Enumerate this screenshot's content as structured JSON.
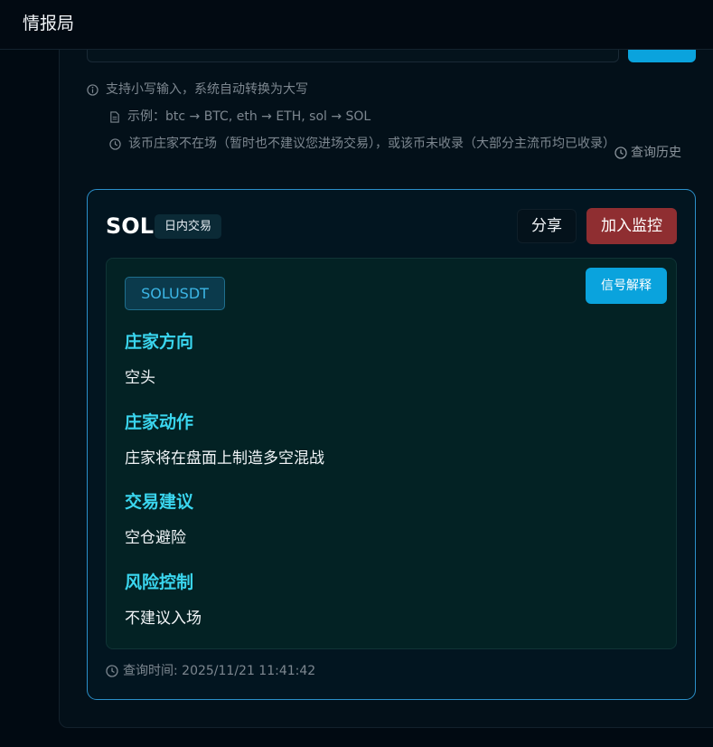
{
  "app": {
    "title": "情报局"
  },
  "hints": {
    "lowercase": "支持小写输入，系统自动转换为大写",
    "example": "示例：btc → BTC, eth → ETH, sol → SOL",
    "notice": "该币庄家不在场（暂时也不建议您进场交易），或该币未收录（大部分主流币均已收录）",
    "history_link": "查询历史"
  },
  "result": {
    "symbol": "SOL",
    "mode": "日内交易",
    "share_label": "分享",
    "watch_label": "加入监控",
    "pair": "SOLUSDT",
    "explain_label": "信号解释",
    "sections": [
      {
        "title": "庄家方向",
        "value": "空头"
      },
      {
        "title": "庄家动作",
        "value": "庄家将在盘面上制造多空混战"
      },
      {
        "title": "交易建议",
        "value": "空仓避险"
      },
      {
        "title": "风险控制",
        "value": "不建议入场"
      }
    ],
    "query_time": "查询时间: 2025/11/21 11:41:42"
  },
  "colors": {
    "accent": "#0aa3dd",
    "danger": "#8f2e31",
    "section_title": "#3ad6ef",
    "card_border": "#2b8fc9"
  }
}
